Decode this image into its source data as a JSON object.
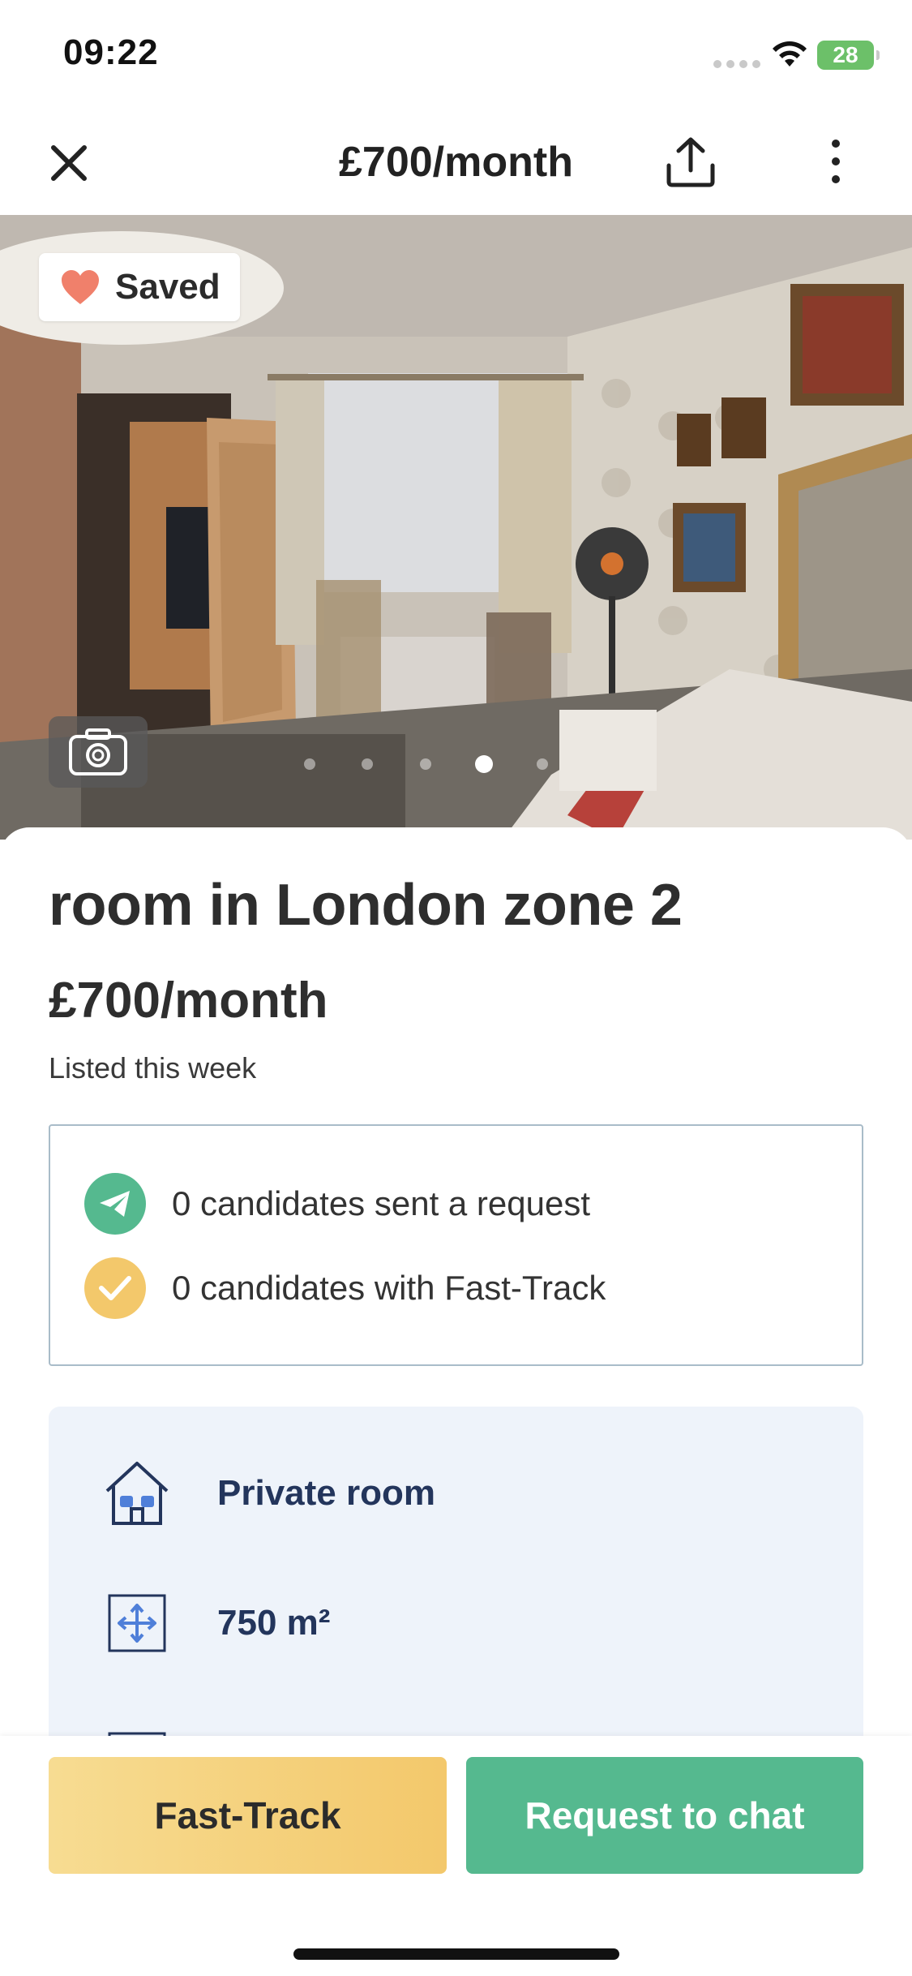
{
  "status_bar": {
    "time": "09:22",
    "battery": "28"
  },
  "header": {
    "title": "£700/month",
    "close_icon": "close-icon",
    "share_icon": "share-icon",
    "more_icon": "more-vertical-icon"
  },
  "hero": {
    "saved_label": "Saved",
    "photo_count_dots": 5,
    "active_photo_index": 3
  },
  "listing": {
    "title": "room in London zone 2",
    "price": "£700/month",
    "listed": "Listed this week"
  },
  "stats": [
    {
      "icon": "send-icon",
      "text": "0 candidates sent a request",
      "color": "#55b98f"
    },
    {
      "icon": "check-icon",
      "text": "0 candidates with Fast-Track",
      "color": "#f3c86b"
    }
  ],
  "features": [
    {
      "icon": "house-icon",
      "label": "Private room"
    },
    {
      "icon": "area-icon",
      "label": "750 m²"
    }
  ],
  "actions": {
    "fast_track": "Fast-Track",
    "request_chat": "Request to chat"
  },
  "colors": {
    "accent_green": "#55b98f",
    "accent_yellow": "#f3c86b",
    "heart": "#f0806b",
    "feature_text": "#23355c"
  }
}
